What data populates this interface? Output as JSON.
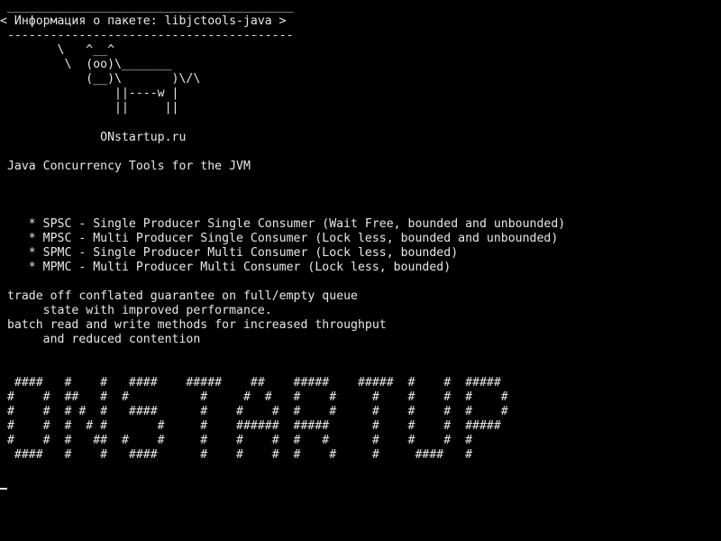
{
  "terminal": {
    "bubble": {
      "top_border": " ________________________________________",
      "text": "< Информация о пакете: libjctools-java >",
      "bottom_border": " ----------------------------------------"
    },
    "cow_art": [
      "        \\   ^__^",
      "         \\  (oo)\\_______",
      "            (__)\\       )\\/\\",
      "                ||----w |",
      "                ||     ||"
    ],
    "site": "              ONstartup.ru",
    "description": " Java Concurrency Tools for the JVM",
    "features": [
      "    * SPSC - Single Producer Single Consumer (Wait Free, bounded and unbounded)",
      "    * MPSC - Multi Producer Single Consumer (Lock less, bounded and unbounded)",
      "    * SPMC - Single Producer Multi Consumer (Lock less, bounded)",
      "    * MPMC - Multi Producer Multi Consumer (Lock less, bounded)"
    ],
    "notes": [
      " trade off conflated guarantee on full/empty queue",
      "      state with improved performance.",
      " batch read and write methods for increased throughput",
      "      and reduced contention"
    ],
    "banner": [
      "  ####   #    #   ####    #####    ##    #####    #####  #    #  #####",
      " #    #  ##   #  #          #     #  #   #    #     #    #    #  #    #",
      " #    #  # #  #   ####      #    #    #  #    #     #    #    #  #    #",
      " #    #  #  # #       #     #    ######  #####      #    #    #  #####",
      " #    #  #   ##  #    #     #    #    #  #   #      #    #    #  #",
      "  ####   #    #   ####      #    #    #  #    #     #     ####   #"
    ]
  }
}
